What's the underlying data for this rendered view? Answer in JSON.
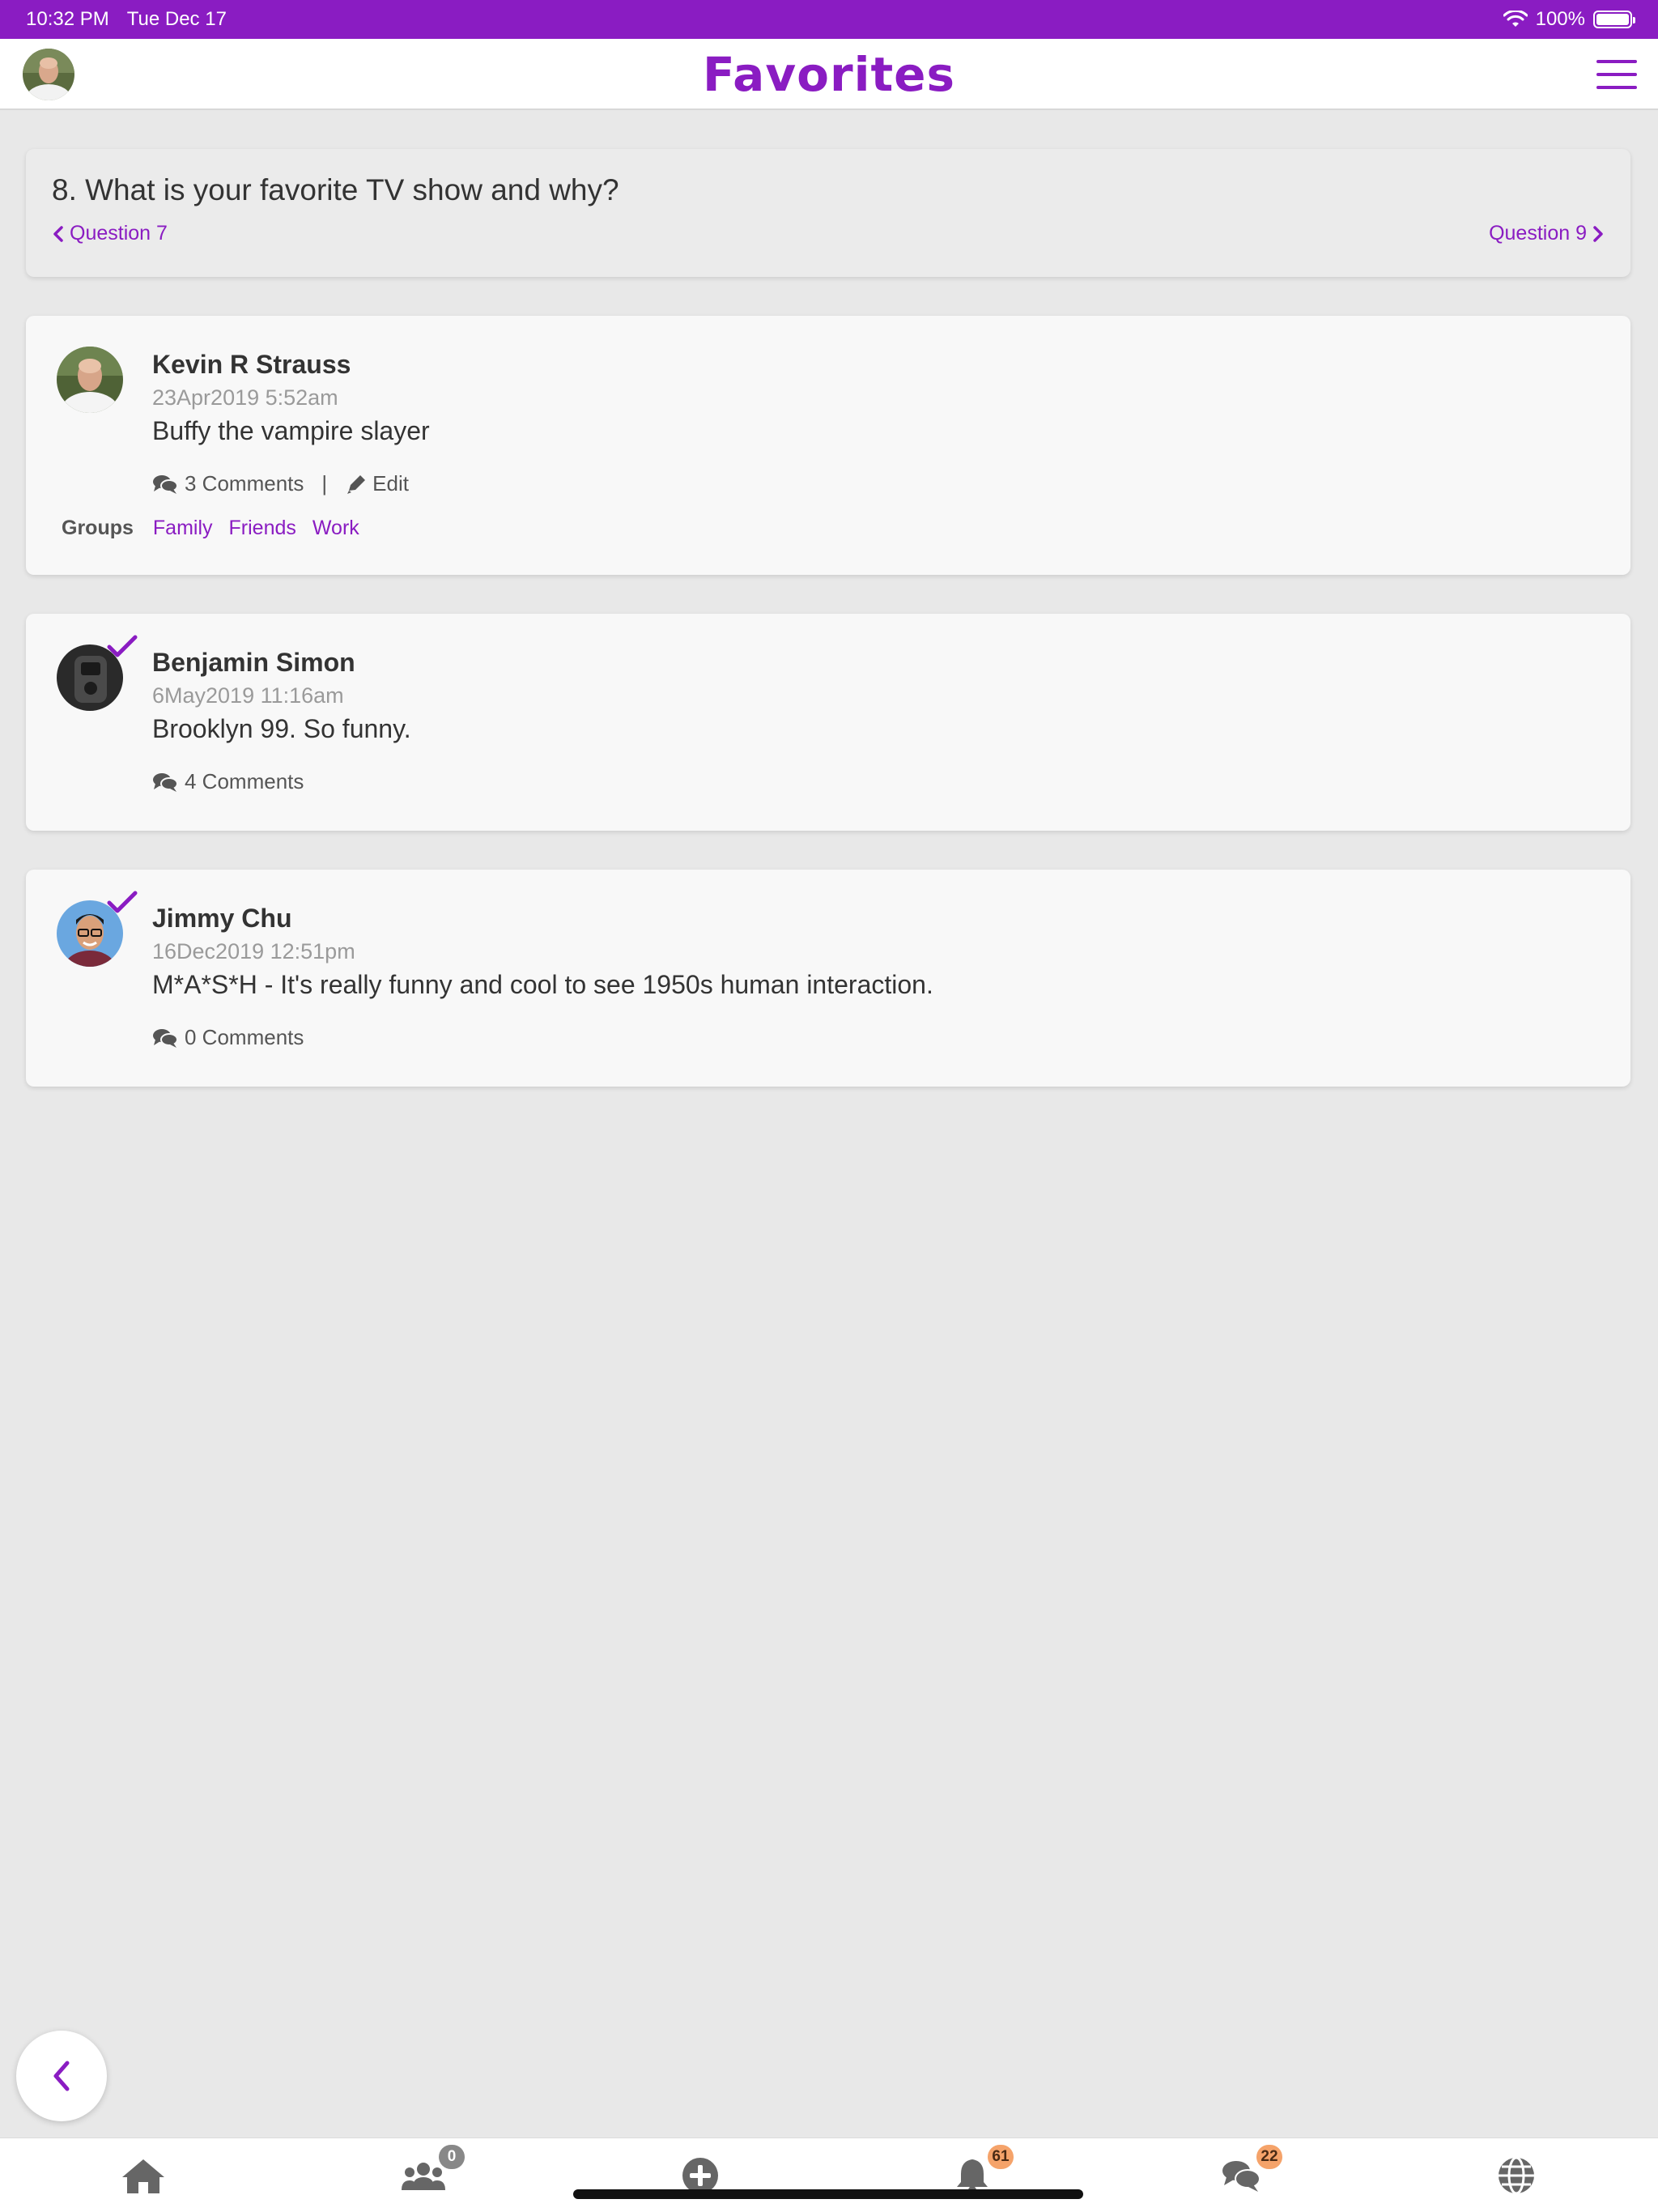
{
  "status_bar": {
    "time": "10:32 PM",
    "date": "Tue Dec 17",
    "battery": "100%",
    "icons": [
      "wifi-icon",
      "battery-icon"
    ]
  },
  "header": {
    "title": "Favorites",
    "menu_icon": "hamburger-menu-icon"
  },
  "question": {
    "text": "8. What is your favorite TV show and why?",
    "prev_label": "Question 7",
    "next_label": "Question 9"
  },
  "answers": [
    {
      "author": "Kevin R Strauss",
      "timestamp": "23Apr2019 5:52am",
      "text": "Buffy the vampire slayer",
      "comments": "3 Comments",
      "separator": "|",
      "edit_label": "Edit",
      "groups_label": "Groups",
      "groups": [
        "Family",
        "Friends",
        "Work"
      ]
    },
    {
      "author": "Benjamin Simon",
      "timestamp": "6May2019 11:16am",
      "text": "Brooklyn 99. So funny.",
      "comments": "4 Comments"
    },
    {
      "author": "Jimmy Chu",
      "timestamp": "16Dec2019 12:51pm",
      "text": "M*A*S*H - It's really funny and cool to see 1950s human interaction.",
      "comments": "0 Comments"
    }
  ],
  "tab_bar": {
    "items": [
      {
        "icon": "home-icon"
      },
      {
        "icon": "people-icon",
        "badge": "0"
      },
      {
        "icon": "plus-circle-icon"
      },
      {
        "icon": "bell-icon",
        "badge": "61"
      },
      {
        "icon": "chat-icon",
        "badge": "22"
      },
      {
        "icon": "globe-icon"
      }
    ]
  },
  "colors": {
    "accent": "#8a1cc2",
    "background": "#e8e8e8",
    "card": "#f8f8f8",
    "badge_orange": "#f5a36a",
    "badge_gray": "#888888"
  }
}
